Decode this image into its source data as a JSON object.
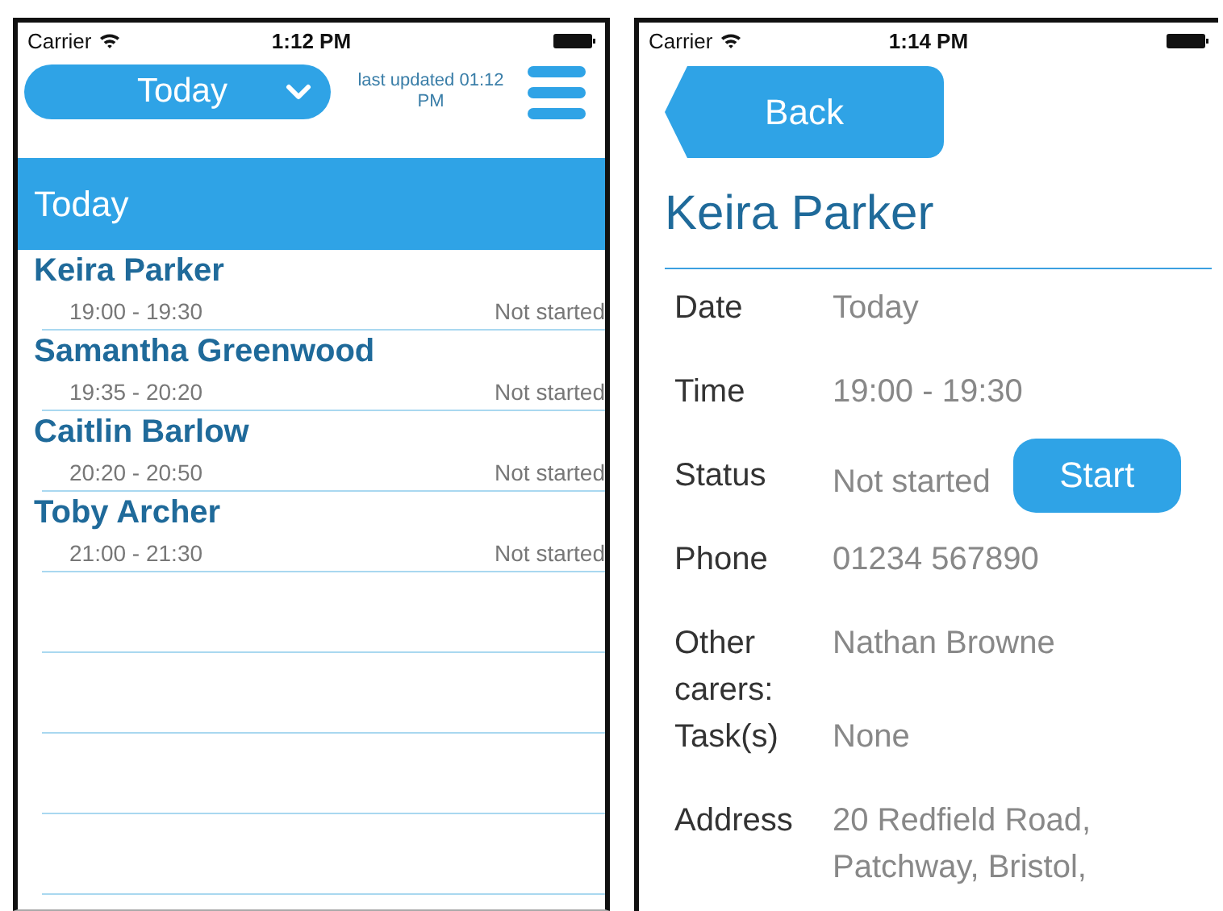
{
  "screens": [
    {
      "status_bar": {
        "carrier": "Carrier",
        "time": "1:12 PM"
      },
      "header": {
        "day_picker": "Today",
        "last_updated": "last updated 01:12 PM"
      },
      "section_title": "Today",
      "appointments": [
        {
          "name": "Keira Parker",
          "time": "19:00 - 19:30",
          "status": "Not started"
        },
        {
          "name": "Samantha Greenwood",
          "time": "19:35 - 20:20",
          "status": "Not started"
        },
        {
          "name": "Caitlin Barlow",
          "time": "20:20 - 20:50",
          "status": "Not started"
        },
        {
          "name": "Toby Archer",
          "time": "21:00 - 21:30",
          "status": "Not started"
        }
      ]
    },
    {
      "status_bar": {
        "carrier": "Carrier",
        "time": "1:14 PM"
      },
      "back_button": "Back",
      "title": "Keira Parker",
      "details": [
        {
          "label": "Date",
          "value": "Today"
        },
        {
          "label": "Time",
          "value": "19:00 - 19:30"
        },
        {
          "label": "Status",
          "value": "Not started",
          "button": "Start"
        },
        {
          "label": "Phone",
          "value": "01234 567890"
        },
        {
          "label": "Other carers:",
          "value": "Nathan Browne"
        },
        {
          "label": "Task(s)",
          "value": "None"
        },
        {
          "label": "Address",
          "value": "20 Redfield Road, Patchway, Bristol,"
        }
      ]
    }
  ]
}
